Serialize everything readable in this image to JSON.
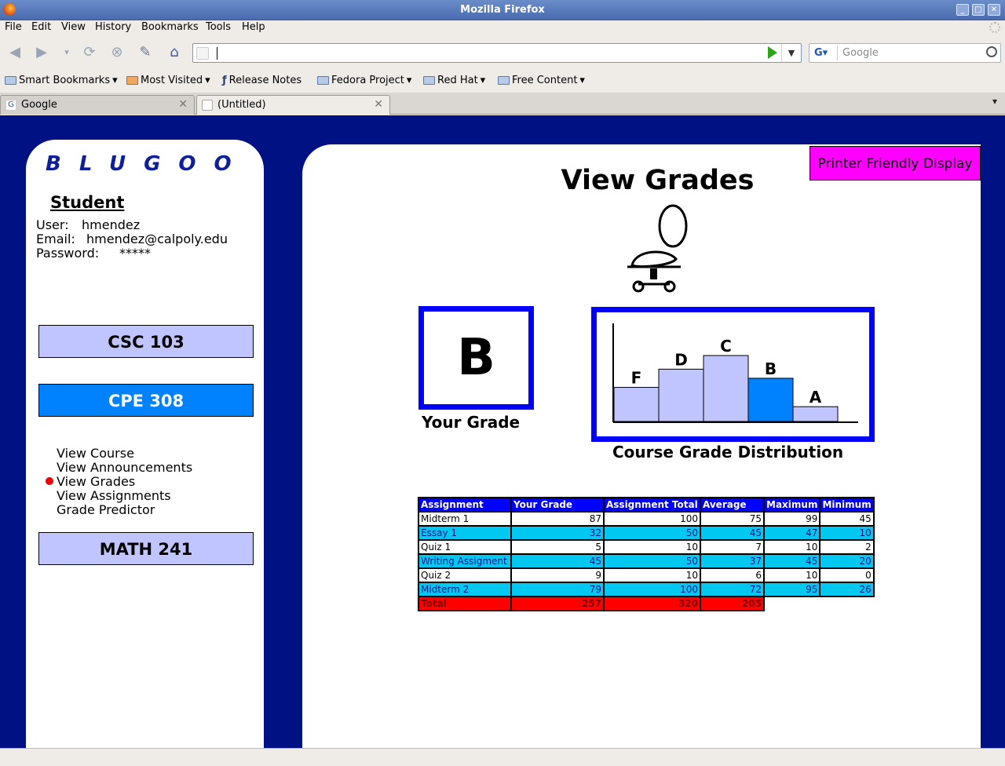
{
  "window": {
    "title": "Mozilla Firefox"
  },
  "menu": [
    "File",
    "Edit",
    "View",
    "History",
    "Bookmarks",
    "Tools",
    "Help"
  ],
  "search": {
    "placeholder": "Google"
  },
  "bookmarks": [
    "Smart Bookmarks",
    "Most Visited",
    "Release Notes",
    "Fedora Project",
    "Red Hat",
    "Free Content"
  ],
  "tabs": [
    {
      "label": "Google"
    },
    {
      "label": "(Untitled)"
    }
  ],
  "sidebar": {
    "logo": "BLUGOO",
    "heading": "Student",
    "user_label": "User:",
    "user_value": "hmendez",
    "email_label": "Email:",
    "email_value": "hmendez@calpoly.edu",
    "password_label": "Password:",
    "password_value": "*****",
    "courses": [
      {
        "label": "CSC 103",
        "color": "#c0c4ff"
      },
      {
        "label": "CPE 308",
        "color": "#0082ff"
      },
      {
        "label": "MATH 241",
        "color": "#c0c4ff"
      }
    ],
    "subnav": [
      "View Course",
      "View Announcements",
      "View Grades",
      "View Assignments",
      "Grade Predictor"
    ],
    "active_subnav": "View Grades"
  },
  "main": {
    "printer_button": "Printer Friendly Display",
    "title": "View Grades",
    "your_grade": "B",
    "your_grade_caption": "Your Grade",
    "distribution_caption": "Course Grade Distribution"
  },
  "chart_data": {
    "type": "bar",
    "categories": [
      "F",
      "D",
      "C",
      "B",
      "A"
    ],
    "values": [
      3,
      4.6,
      5.8,
      3.8,
      1.3
    ],
    "highlight": "B",
    "bar_color": "#c0c4ff",
    "highlight_color": "#0082ff"
  },
  "table": {
    "headers": [
      "Assignment",
      "Your Grade",
      "Assignment Total",
      "Average",
      "Maximum",
      "Minimum"
    ],
    "rows": [
      [
        "Midterm 1",
        "87",
        "100",
        "75",
        "99",
        "45"
      ],
      [
        "Essay 1",
        "32",
        "50",
        "45",
        "47",
        "10"
      ],
      [
        "Quiz 1",
        "5",
        "10",
        "7",
        "10",
        "2"
      ],
      [
        "Writing Assigment",
        "45",
        "50",
        "37",
        "45",
        "20"
      ],
      [
        "Quiz 2",
        "9",
        "10",
        "6",
        "10",
        "0"
      ],
      [
        "Midterm 2",
        "79",
        "100",
        "72",
        "95",
        "26"
      ]
    ],
    "total": [
      "Total",
      "257",
      "320",
      "205"
    ]
  }
}
